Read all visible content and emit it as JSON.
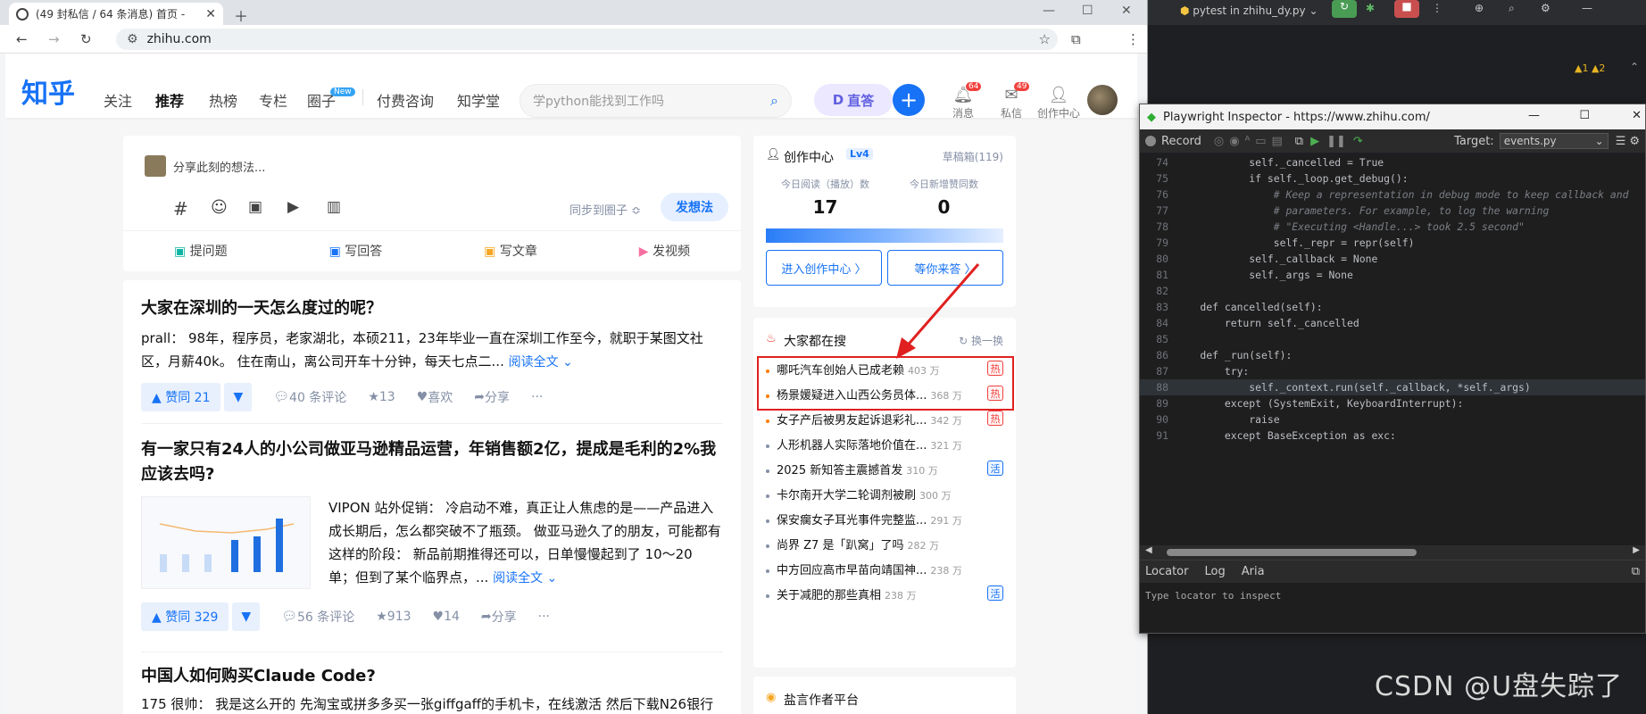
{
  "browser": {
    "tab_title": "(49 封私信 / 64 条消息) 首页 -",
    "url": "zhihu.com"
  },
  "zhihu": {
    "logo": "知乎",
    "nav": [
      "关注",
      "推荐",
      "热榜",
      "专栏",
      "圈子",
      "付费咨询",
      "知学堂"
    ],
    "nav_new_badge": "New",
    "search_placeholder": "学python能找到工作吗",
    "zhida_label": "直答",
    "top_icons": [
      {
        "label": "消息",
        "badge": "64"
      },
      {
        "label": "私信",
        "badge": "49"
      },
      {
        "label": "创作中心",
        "badge": ""
      }
    ],
    "composer": {
      "placeholder": "分享此刻的想法...",
      "sync_label": "同步到圈子 ≎",
      "publish_label": "发想法",
      "actions": [
        "提问题",
        "写回答",
        "写文章",
        "发视频"
      ]
    },
    "feed": [
      {
        "title": "大家在深圳的一天怎么度过的呢？",
        "excerpt": "prall： 98年，程序员，老家湖北，本硕211，23年毕业一直在深圳工作至今，就职于某图文社区，月薪40k。 住在南山，离公司开车十分钟，每天七点二...",
        "read_more": "阅读全文 ⌄",
        "vote": "▲ 赞同 21",
        "comments": "40 条评论",
        "stars": "13",
        "like": "喜欢",
        "share": "分享"
      },
      {
        "title": "有一家只有24人的小公司做亚马逊精品运营，年销售额2亿，提成是毛利的2%我应该去吗?",
        "excerpt": "VIPON 站外促销： 冷启动不难，真正让人焦虑的是——产品进入成长期后，怎么都突破不了瓶颈。 做亚马逊久了的朋友，可能都有这样的阶段： 新品前期推得还可以，日单慢慢起到了 10～20 单；但到了某个临界点，...",
        "read_more": "阅读全文 ⌄",
        "vote": "▲ 赞同 329",
        "comments": "56 条评论",
        "stars": "913",
        "like": "14",
        "share": "分享"
      },
      {
        "title": "中国人如何购买Claude Code?",
        "excerpt": "175 很帅： 我是这么开的 先淘宝或拼多多买一张giffgaff的手机卡，在线激活 然后下载N26银行"
      }
    ],
    "creator": {
      "title": "创作中心",
      "level": "Lv4",
      "drafts": "草稿箱(119)",
      "stat1_label": "今日阅读（播放）数",
      "stat1_value": "17",
      "stat2_label": "今日新增赞同数",
      "stat2_value": "0",
      "btn1": "进入创作中心 〉",
      "btn2": "等你来答 〉"
    },
    "hot": {
      "title": "大家都在搜",
      "refresh": "换一换",
      "items": [
        {
          "text": "哪吒汽车创始人已成老赖",
          "hits": "403 万",
          "tag": "热"
        },
        {
          "text": "杨景媛疑进入山西公务员体...",
          "hits": "368 万",
          "tag": "热"
        },
        {
          "text": "女子产后被男友起诉退彩礼...",
          "hits": "342 万",
          "tag": "热"
        },
        {
          "text": "人形机器人实际落地价值在...",
          "hits": "321 万",
          "tag": ""
        },
        {
          "text": "2025 新知答主震撼首发",
          "hits": "310 万",
          "tag": "活"
        },
        {
          "text": "卡尔南开大学二轮调剂被刷",
          "hits": "300 万",
          "tag": ""
        },
        {
          "text": "保安瘸女子耳光事件完整监...",
          "hits": "291 万",
          "tag": ""
        },
        {
          "text": "尚界 Z7 是「趴窝」了吗",
          "hits": "282 万",
          "tag": ""
        },
        {
          "text": "中方回应高市早苗向靖国神...",
          "hits": "238 万",
          "tag": ""
        },
        {
          "text": "关于减肥的那些真相",
          "hits": "238 万",
          "tag": "活"
        }
      ]
    },
    "salt": "盐言作者平台"
  },
  "ide": {
    "run_title": "pytest in zhihu_dy.py",
    "warnings": "▲1 ▲2",
    "inspector_title": "Playwright Inspector - https://www.zhihu.com/",
    "record_label": "Record",
    "target_label": "Target:",
    "target_value": "events.py",
    "tabs": [
      "Locator",
      "Log",
      "Aria"
    ],
    "locator_placeholder": "Type locator to inspect"
  },
  "code_lines": [
    {
      "n": "74",
      "t": "            self._cancelled = True"
    },
    {
      "n": "75",
      "t": "            if self._loop.get_debug():"
    },
    {
      "n": "76",
      "t": "                # Keep a representation in debug mode to keep callback and"
    },
    {
      "n": "77",
      "t": "                # parameters. For example, to log the warning"
    },
    {
      "n": "78",
      "t": "                # \"Executing <Handle...> took 2.5 second\""
    },
    {
      "n": "79",
      "t": "                self._repr = repr(self)"
    },
    {
      "n": "80",
      "t": "            self._callback = None"
    },
    {
      "n": "81",
      "t": "            self._args = None"
    },
    {
      "n": "82",
      "t": ""
    },
    {
      "n": "83",
      "t": "    def cancelled(self):"
    },
    {
      "n": "84",
      "t": "        return self._cancelled"
    },
    {
      "n": "85",
      "t": ""
    },
    {
      "n": "86",
      "t": "    def _run(self):"
    },
    {
      "n": "87",
      "t": "        try:"
    },
    {
      "n": "88",
      "t": "            self._context.run(self._callback, *self._args)"
    },
    {
      "n": "89",
      "t": "        except (SystemExit, KeyboardInterrupt):"
    },
    {
      "n": "90",
      "t": "            raise"
    },
    {
      "n": "91",
      "t": "        except BaseException as exc:"
    }
  ],
  "watermark": "CSDN @U盘失踪了"
}
